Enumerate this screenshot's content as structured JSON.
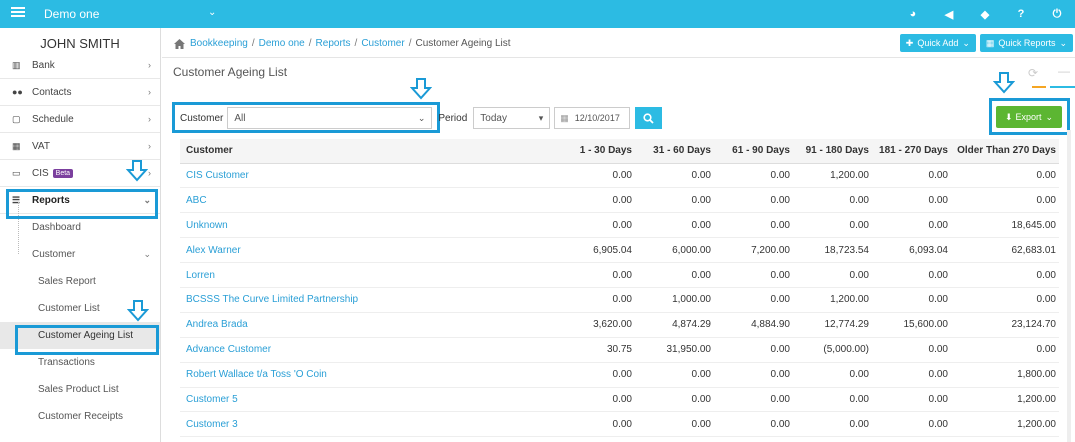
{
  "topbar": {
    "company": "Demo one",
    "icons": [
      "palette-icon",
      "megaphone-icon",
      "ticket-icon",
      "help-icon",
      "power-icon"
    ]
  },
  "sidebar": {
    "user": "JOHN SMITH",
    "items": [
      {
        "label": "Bank",
        "icon": "bank-icon"
      },
      {
        "label": "Contacts",
        "icon": "users-icon"
      },
      {
        "label": "Schedule",
        "icon": "calendar-icon"
      },
      {
        "label": "VAT",
        "icon": "calculator-icon"
      },
      {
        "label": "CIS",
        "icon": "card-icon",
        "badge": "Beta"
      },
      {
        "label": "Reports",
        "icon": "list-icon"
      }
    ],
    "report_sub": {
      "dashboard": "Dashboard",
      "customer": "Customer"
    },
    "customer_sub": [
      "Sales Report",
      "Customer List",
      "Customer Ageing List",
      "Transactions",
      "Sales Product List",
      "Customer Receipts"
    ]
  },
  "breadcrumb": {
    "items": [
      "Bookkeeping",
      "Demo one",
      "Reports",
      "Customer"
    ],
    "current": "Customer Ageing List"
  },
  "buttons": {
    "quick_add": "Quick Add",
    "quick_reports": "Quick Reports",
    "export": "Export"
  },
  "page_title": "Customer Ageing List",
  "filters": {
    "customer_label": "Customer",
    "customer_value": "All",
    "period_label": "Period",
    "period_value": "Today",
    "date": "12/10/2017"
  },
  "table": {
    "headers": [
      "Customer",
      "1 - 30 Days",
      "31 - 60 Days",
      "61 - 90 Days",
      "91 - 180 Days",
      "181 - 270 Days",
      "Older Than 270 Days"
    ],
    "rows": [
      [
        "CIS Customer",
        "0.00",
        "0.00",
        "0.00",
        "1,200.00",
        "0.00",
        "0.00"
      ],
      [
        "ABC",
        "0.00",
        "0.00",
        "0.00",
        "0.00",
        "0.00",
        "0.00"
      ],
      [
        "Unknown",
        "0.00",
        "0.00",
        "0.00",
        "0.00",
        "0.00",
        "18,645.00"
      ],
      [
        "Alex Warner",
        "6,905.04",
        "6,000.00",
        "7,200.00",
        "18,723.54",
        "6,093.04",
        "62,683.01"
      ],
      [
        "Lorren",
        "0.00",
        "0.00",
        "0.00",
        "0.00",
        "0.00",
        "0.00"
      ],
      [
        "BCSSS The Curve Limited Partnership",
        "0.00",
        "1,000.00",
        "0.00",
        "1,200.00",
        "0.00",
        "0.00"
      ],
      [
        "Andrea Brada",
        "3,620.00",
        "4,874.29",
        "4,884.90",
        "12,774.29",
        "15,600.00",
        "23,124.70"
      ],
      [
        "Advance Customer",
        "30.75",
        "31,950.00",
        "0.00",
        "(5,000.00)",
        "0.00",
        "0.00"
      ],
      [
        "Robert Wallace t/a Toss 'O Coin",
        "0.00",
        "0.00",
        "0.00",
        "0.00",
        "0.00",
        "1,800.00"
      ],
      [
        "Customer 5",
        "0.00",
        "0.00",
        "0.00",
        "0.00",
        "0.00",
        "1,200.00"
      ],
      [
        "Customer 3",
        "0.00",
        "0.00",
        "0.00",
        "0.00",
        "0.00",
        "1,200.00"
      ]
    ]
  },
  "colors": {
    "topbar": "#2cbbe3",
    "link": "#2a9fd6",
    "export": "#5cb632",
    "highlight": "#1a9ad6"
  }
}
